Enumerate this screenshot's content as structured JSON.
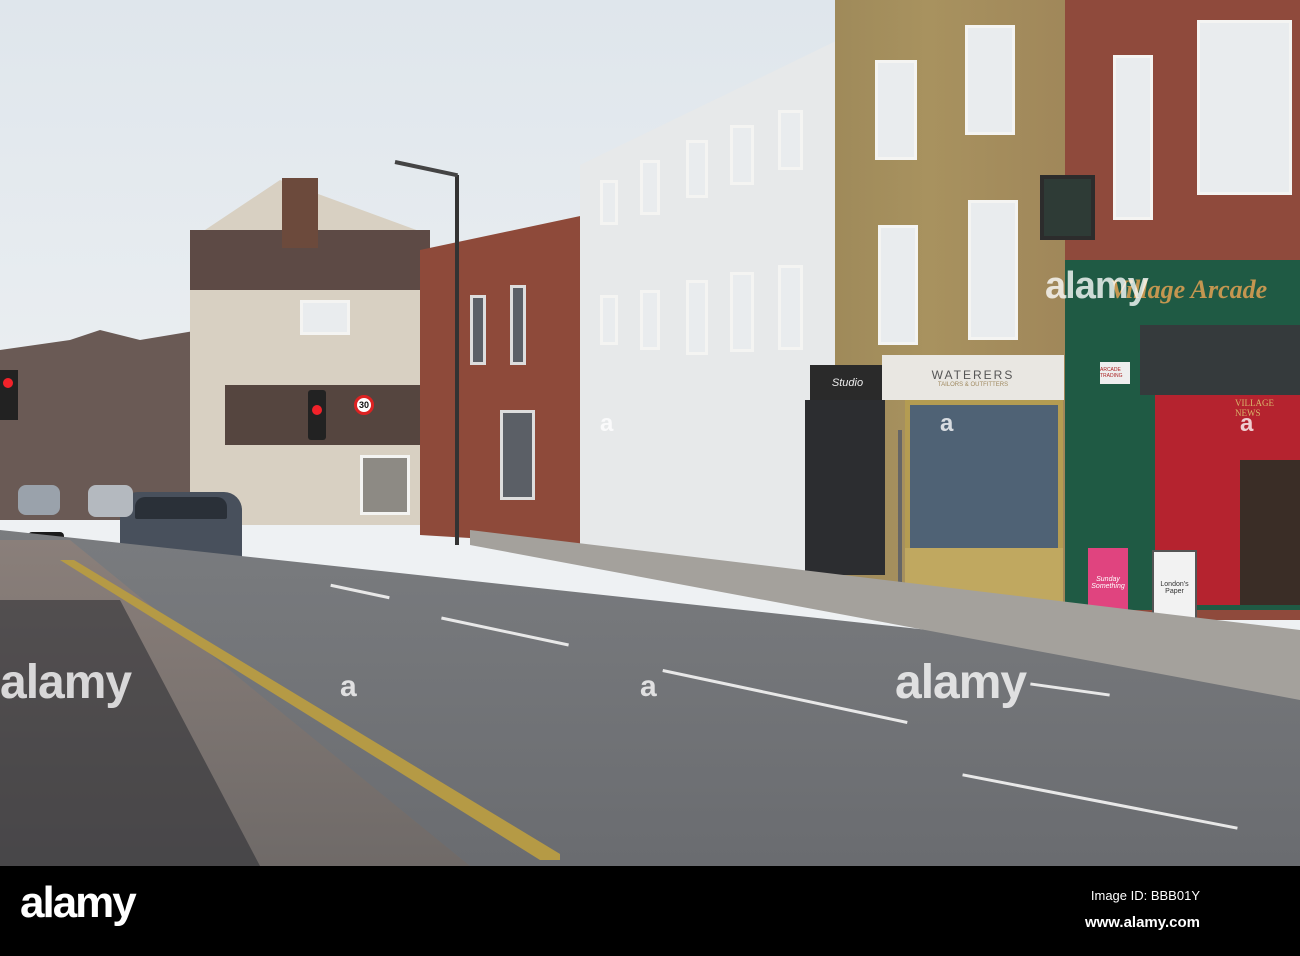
{
  "watermark": {
    "brand": "alamy",
    "small": "a"
  },
  "signs": {
    "speed_limit": "30",
    "studio": "Studio",
    "waterers": "WATERERS",
    "waterers_sub": "TAILORS & OUTFITTERS",
    "village_arcade": "Village Arcade",
    "village_news": "VILLAGE NEWS",
    "arcade_sign": "ARCADE TRADING",
    "board_left": "Sunday Something",
    "board_right": "London's Paper"
  },
  "footer": {
    "logo": "alamy",
    "image_id": "Image ID: BBB01Y",
    "url": "www.alamy.com"
  },
  "colors": {
    "shopfront_green": "#1f5a44",
    "shop_red": "#b5232f",
    "brick": "#9a5040",
    "yellow_brick": "#a8925f"
  }
}
